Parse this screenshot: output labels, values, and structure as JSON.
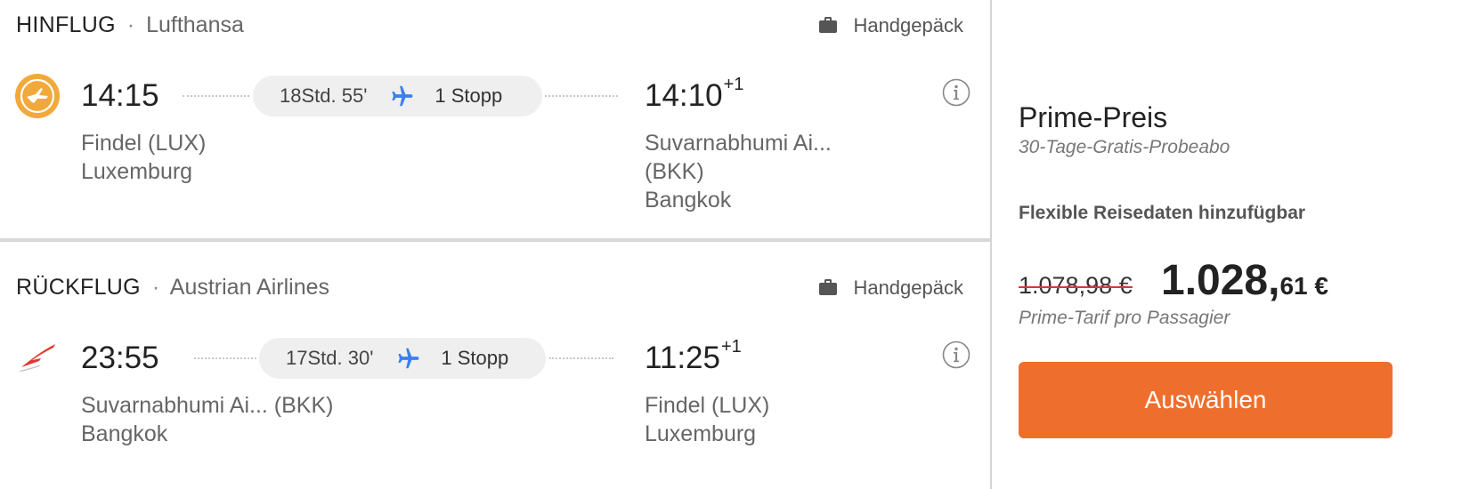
{
  "outbound": {
    "direction": "HINFLUG",
    "separator": "·",
    "airline": "Lufthansa",
    "airline_logo": "lufthansa-crane-logo",
    "baggage": "Handgepäck",
    "baggage_icon": "suitcase-icon",
    "dep_time": "14:15",
    "duration": "18Std. 55'",
    "stops": "1 Stopp",
    "arr_time": "14:10",
    "arr_day_offset": "+1",
    "dep_airport": "Findel (LUX)",
    "dep_city": "Luxemburg",
    "arr_airport_line1": "Suvarnabhumi Ai...",
    "arr_airport_line2": "(BKK)",
    "arr_city": "Bangkok"
  },
  "return": {
    "direction": "RÜCKFLUG",
    "separator": "·",
    "airline": "Austrian Airlines",
    "airline_logo": "austrian-airlines-logo",
    "baggage": "Handgepäck",
    "baggage_icon": "suitcase-icon",
    "dep_time": "23:55",
    "duration": "17Std. 30'",
    "stops": "1 Stopp",
    "arr_time": "11:25",
    "arr_day_offset": "+1",
    "dep_airport": "Suvarnabhumi Ai... (BKK)",
    "dep_city": "Bangkok",
    "arr_airport": "Findel (LUX)",
    "arr_city": "Luxemburg"
  },
  "pricing": {
    "title": "Prime-Preis",
    "subtitle": "30-Tage-Gratis-Probeabo",
    "flexible_dates": "Flexible Reisedaten hinzufügbar",
    "old_price": "1.078,98 €",
    "new_price_major": "1.028,",
    "new_price_minor": "61 €",
    "price_note": "Prime-Tarif pro Passagier",
    "select_label": "Auswählen"
  },
  "colors": {
    "accent_button": "#ee6f2d",
    "plane_icon": "#3b7ff0",
    "strike_line": "#d8363a",
    "lufthansa_yellow": "#f2a93b",
    "austrian_red": "#e03a32"
  }
}
